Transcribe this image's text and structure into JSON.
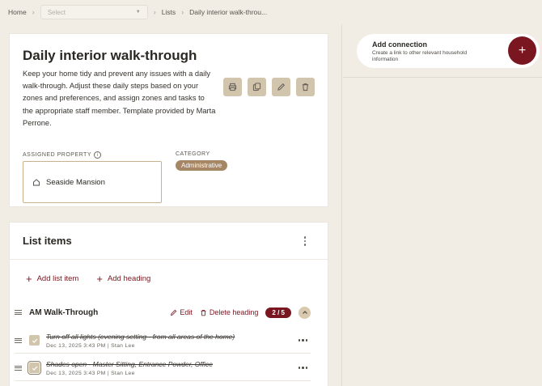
{
  "breadcrumb": {
    "home": "Home",
    "select_placeholder": "Select",
    "lists": "Lists",
    "current": "Daily interior walk-throu..."
  },
  "list": {
    "title": "Daily interior walk-through",
    "description": "Keep your home tidy and prevent any issues with a daily walk-through. Adjust these daily steps based on your zones and preferences, and assign zones and tasks to the appropriate staff member. Template provided by Marta Perrone.",
    "assigned_property_label": "ASSIGNED PROPERTY",
    "assigned_property": "Seaside Mansion",
    "category_label": "CATEGORY",
    "category": "Administrative"
  },
  "list_items": {
    "title": "List items",
    "add_item": "Add list item",
    "add_heading": "Add heading",
    "section": {
      "title": "AM Walk-Through",
      "edit": "Edit",
      "delete": "Delete heading",
      "count": "2 / 5",
      "tasks": [
        {
          "name": "Turn off all lights (evening setting - from all areas of the home)",
          "meta": "Dec 13, 2025 3:43 PM | Stan Lee"
        },
        {
          "name": "Shades open - Master Sitting, Entrance Powder, Office",
          "meta": "Dec 13, 2025 3:43 PM | Stan Lee"
        }
      ]
    }
  },
  "connection": {
    "title": "Add connection",
    "subtitle": "Create a link to other relevant household information"
  },
  "colors": {
    "accent": "#7a1620",
    "tan": "#d2c5ad",
    "badge": "#a58766"
  }
}
